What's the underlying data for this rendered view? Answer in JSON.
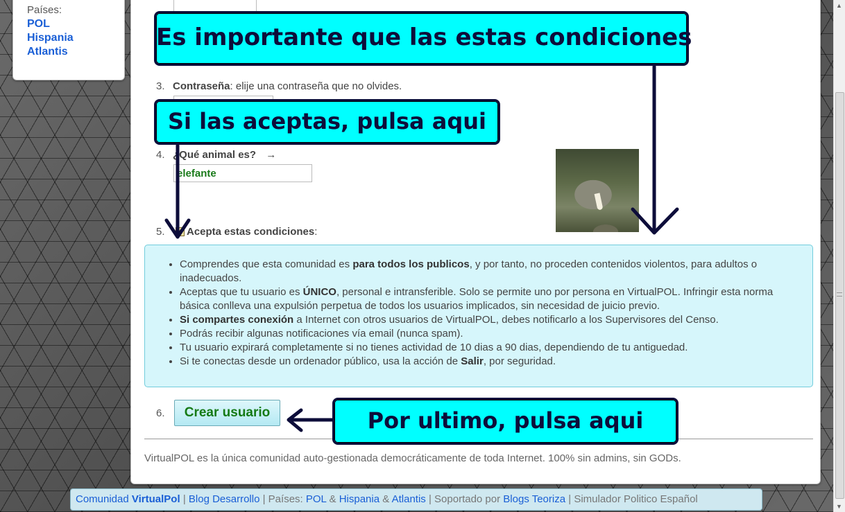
{
  "sidebar": {
    "label": "Países:",
    "countries": [
      "POL",
      "Hispania",
      "Atlantis"
    ]
  },
  "form": {
    "step3": {
      "num": "3.",
      "label": "Contraseña",
      "text": ": elije una contraseña que no olvides."
    },
    "step4": {
      "num": "4.",
      "label": "¿Qué animal es?",
      "arrow": "→",
      "value": "elefante"
    },
    "step5": {
      "num": "5.",
      "checkbox_mark": "✔",
      "label": "Acepta estas condiciones",
      "colon": ":"
    },
    "step6": {
      "num": "6.",
      "button": "Crear usuario"
    }
  },
  "conditions": [
    {
      "pre": "Comprendes que esta comunidad es ",
      "bold": "para todos los publicos",
      "post": ", y por tanto, no proceden contenidos violentos, para adultos o inadecuados."
    },
    {
      "pre": "Aceptas que tu usuario es ",
      "bold": "ÚNICO",
      "post": ", personal e intransferible. Solo se permite uno por persona en VirtualPOL. Infringir esta norma básica conlleva una expulsión perpetua de todos los usuarios implicados, sin necesidad de juicio previo."
    },
    {
      "pre": "",
      "bold": "Si compartes conexión",
      "post": " a Internet con otros usuarios de VirtualPOL, debes notificarlo a los Supervisores del Censo."
    },
    {
      "pre": "Podrás recibir algunas notificaciones vía email (nunca spam).",
      "bold": "",
      "post": ""
    },
    {
      "pre": "Tu usuario expirará completamente si no tienes actividad de 10 dias a 90 dias, dependiendo de tu antiguedad.",
      "bold": "",
      "post": ""
    },
    {
      "pre": "Si te conectas desde un ordenador público, usa la acción de ",
      "bold": "Salir",
      "post": ", por seguridad."
    }
  ],
  "footer_text": "VirtualPOL es la única comunidad auto-gestionada democráticamente de toda Internet. 100% sin admins, sin GODs.",
  "bottom_bar": {
    "comunidad": "Comunidad",
    "virtualpol": "VirtualPol",
    "sep1": "|",
    "blog": "Blog Desarrollo",
    "sep2": "| Países:",
    "pol": "POL",
    "amp1": "&",
    "hispania": "Hispania",
    "amp2": "&",
    "atlantis": "Atlantis",
    "sep3": "| Soportado por",
    "teoriza": "Blogs Teoriza",
    "sep4": "| Simulador Politico Español"
  },
  "callouts": {
    "c1": "Es importante que las estas condiciones",
    "c2": "Si las aceptas, pulsa aqui",
    "c3": "Por ultimo, pulsa aqui"
  },
  "icons": {
    "scroll_up": "▲",
    "scroll_down": "▼"
  },
  "colors": {
    "callout_bg": "#00ffff",
    "callout_border": "#0d0d3a",
    "conditions_bg": "#d6f6fb",
    "link": "#1a5fd6",
    "button_text": "#157a15"
  }
}
